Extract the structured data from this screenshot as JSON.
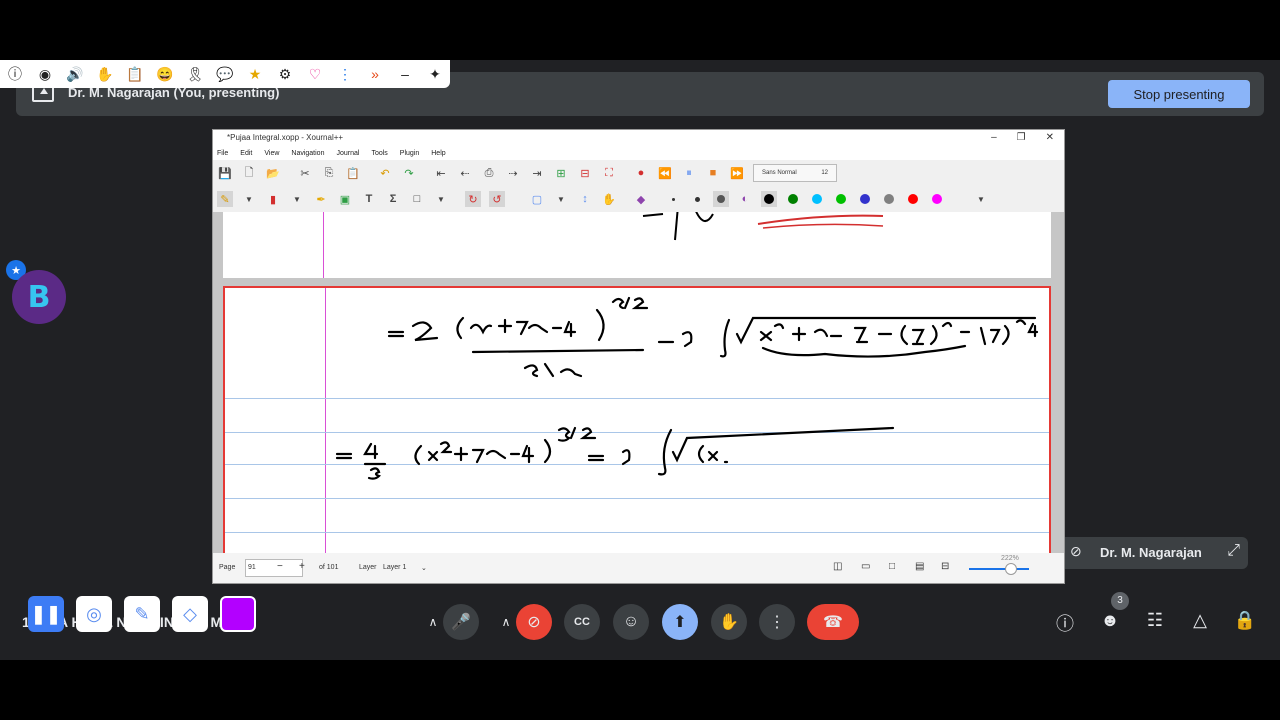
{
  "banner": {
    "presenter_text": "Dr. M. Nagarajan (You, presenting)",
    "stop_label": "Stop presenting"
  },
  "floating_toolbar": {
    "icons": [
      "info-icon",
      "eye-icon",
      "volume-icon",
      "hand-icon",
      "clipboard-icon",
      "emoji-icon",
      "ribbon-icon",
      "chat-icon",
      "star-icon",
      "gear-icon",
      "heart-icon",
      "more-vert-icon",
      "chevrons-icon",
      "minimize-icon",
      "move-icon"
    ]
  },
  "xournal": {
    "title": "*Pujaa Integral.xopp - Xournal++",
    "menu": [
      "File",
      "Edit",
      "View",
      "Navigation",
      "Journal",
      "Tools",
      "Plugin",
      "Help"
    ],
    "font_name": "Sans Normal",
    "font_size": "12",
    "colors": [
      "#000000",
      "#008000",
      "#00c0ff",
      "#00c000",
      "#3333cc",
      "#808080",
      "#ff0000",
      "#ff00ff"
    ],
    "status": {
      "page_label": "Page",
      "page_value": "91",
      "of_pages": "of 101",
      "layer_label": "Layer",
      "layer_value": "Layer 1",
      "zoom": "222%"
    }
  },
  "pip": {
    "name": "Dr. M. Nagarajan"
  },
  "bottom": {
    "meeting_title": "1  PM  A  HC  TL  N ONLINE-Dr. M. ...",
    "participants_count": "3",
    "accent_red": "#ea4335",
    "accent_blue": "#8ab4f8"
  }
}
